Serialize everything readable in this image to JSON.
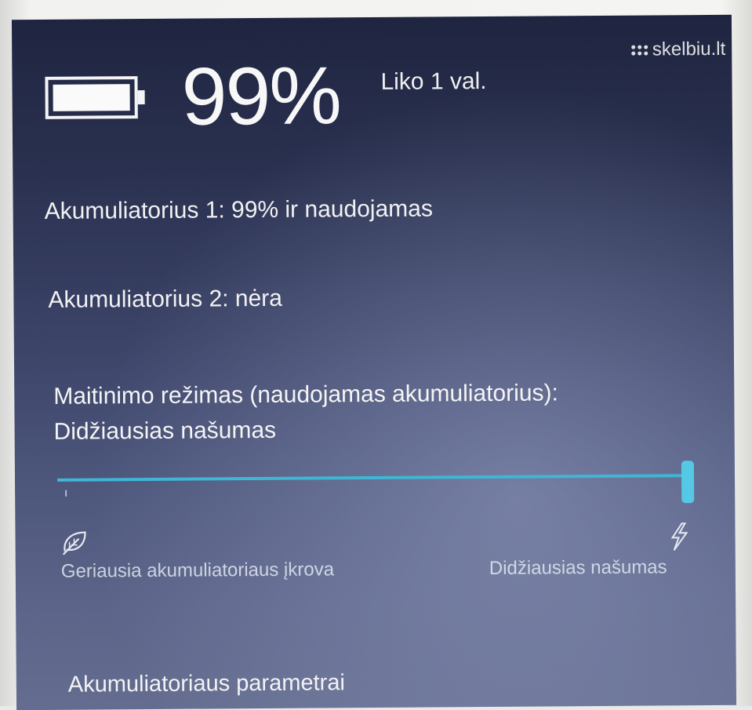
{
  "battery": {
    "percent_text": "99%",
    "percent_value": 99,
    "remaining": "Liko 1 val."
  },
  "watermark": {
    "text": "skelbiu.lt"
  },
  "batteries": [
    {
      "text": "Akumuliatorius 1: 99% ir naudojamas"
    },
    {
      "text": "Akumuliatorius 2: nėra"
    }
  ],
  "power_mode": {
    "label": "Maitinimo režimas (naudojamas akumuliatorius):",
    "current": "Didžiausias našumas",
    "slider_level": 1.0,
    "accent_color": "#3fb6d6",
    "min_label": "Geriausia akumuliatoriaus įkrova",
    "max_label": "Didžiausias našumas",
    "min_icon": "leaf-icon",
    "max_icon": "lightning-bolt-icon"
  },
  "settings_link": "Akumuliatoriaus parametrai"
}
